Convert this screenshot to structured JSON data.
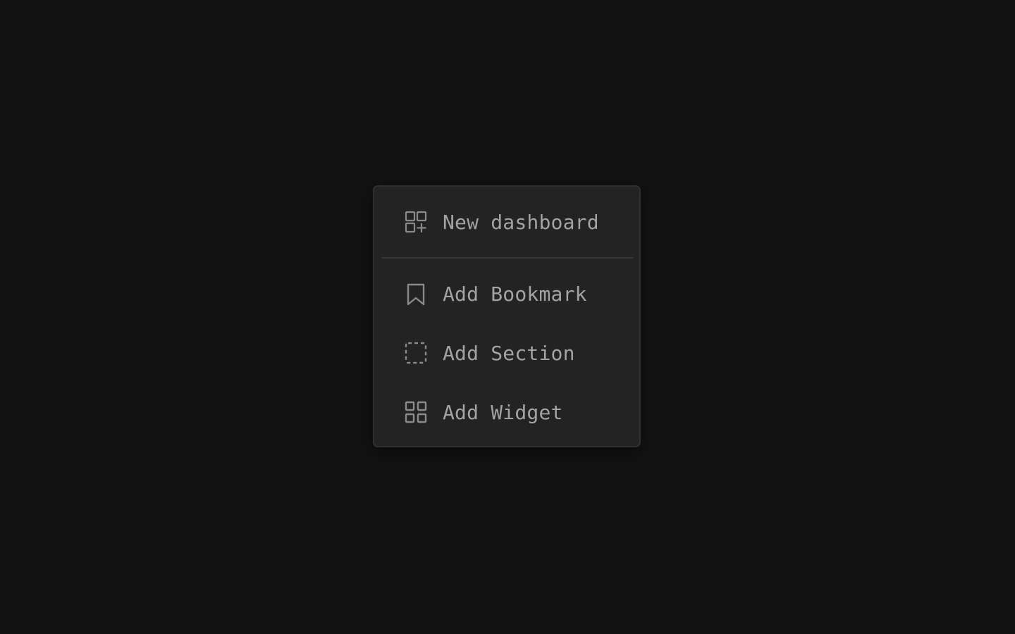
{
  "menu": {
    "items": [
      {
        "label": "New dashboard",
        "icon": "dashboard-plus-icon"
      },
      {
        "label": "Add Bookmark",
        "icon": "bookmark-icon"
      },
      {
        "label": "Add Section",
        "icon": "dashed-square-icon"
      },
      {
        "label": "Add Widget",
        "icon": "grid-icon"
      }
    ]
  },
  "colors": {
    "background": "#121212",
    "menu_background": "#232323",
    "menu_border": "#2f2f2f",
    "text": "#a3a3a3",
    "icon": "#8a8a8a",
    "divider": "#353535"
  }
}
